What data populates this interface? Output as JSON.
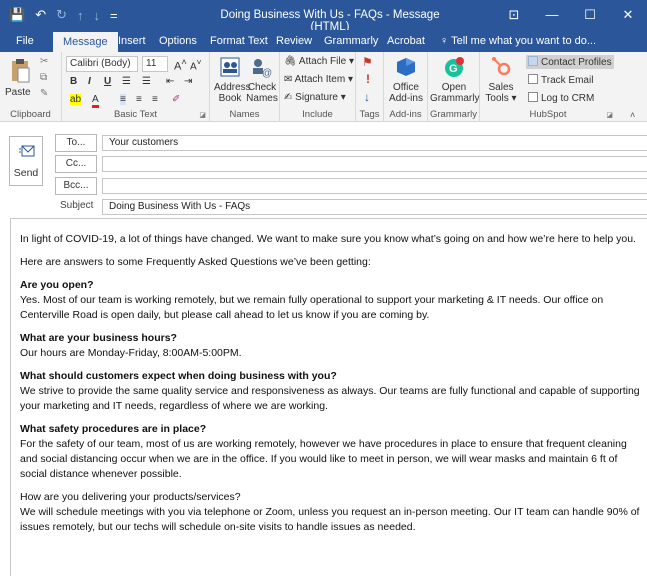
{
  "window": {
    "title": "Doing Business With Us - FAQs  -  Message (HTML)",
    "controls": [
      "⊡",
      "—",
      "☐",
      "✕"
    ]
  },
  "qat": [
    "💾",
    "↶",
    "↻",
    "↑",
    "↓",
    "="
  ],
  "tabs": [
    "File",
    "Message",
    "Insert",
    "Options",
    "Format Text",
    "Review",
    "Grammarly",
    "Acrobat"
  ],
  "active_tab": "Message",
  "tell_me": "Tell me what you want to do...",
  "ribbon": {
    "clipboard": {
      "paste": "Paste",
      "label": "Clipboard"
    },
    "basic_text": {
      "font": "Calibri (Body)",
      "size": "11",
      "label": "Basic Text",
      "bold": "B",
      "italic": "I",
      "underline": "U"
    },
    "names": {
      "address_book": "Address Book",
      "check_names": "Check Names",
      "label": "Names"
    },
    "include": {
      "attach_file": "Attach File",
      "attach_item": "Attach Item",
      "signature": "Signature",
      "label": "Include"
    },
    "tags": {
      "label": "Tags"
    },
    "addins": {
      "office_addins": "Office Add-ins",
      "label": "Add-ins"
    },
    "grammarly": {
      "open": "Open Grammarly",
      "label": "Grammarly"
    },
    "hubspot": {
      "sales_tools": "Sales Tools",
      "contact_profiles": "Contact Profiles",
      "track_email": "Track Email",
      "log_to_crm": "Log to CRM",
      "label": "HubSpot"
    },
    "accent": "#2b579a"
  },
  "compose": {
    "send": "Send",
    "to_btn": "To...",
    "cc_btn": "Cc...",
    "bcc_btn": "Bcc...",
    "to_value": "Your customers",
    "cc_value": "",
    "bcc_value": "",
    "subject_label": "Subject",
    "subject_value": "Doing Business With Us - FAQs"
  },
  "message": {
    "intro": "In light of COVID-19, a lot of things have changed. We want to make sure you know what’s going on and how we’re here to help you.",
    "lead": "Here are answers to some Frequently Asked Questions we’ve been getting:",
    "q1": "Are you open?",
    "a1": "Yes. Most of our team is working remotely, but we remain fully operational to support your marketing & IT needs. Our office on Centerville Road is open daily, but please call ahead to let us know if you are coming by.",
    "q2": "What are your business hours?",
    "a2": "Our hours are Monday-Friday, 8:00AM-5:00PM.",
    "q3": "What should customers expect when doing business with you?",
    "a3": "We strive to provide the same quality service and responsiveness as always. Our teams are fully functional and capable of supporting your marketing and IT needs, regardless of where we are working.",
    "q4": "What safety procedures are in place?",
    "a4": "For the safety of our team, most of us are working remotely, however we have procedures in place to ensure that frequent cleaning and social distancing occur when we are in the office. If you would like to meet in person, we will wear masks and maintain 6 ft of social distance whenever possible.",
    "q5": "How are you delivering your products/services?",
    "a5": "We will schedule meetings with you via telephone or Zoom, unless you request an in-person meeting. Our IT team can handle 90% of issues remotely, but our techs will schedule on-site visits to handle issues as needed."
  }
}
